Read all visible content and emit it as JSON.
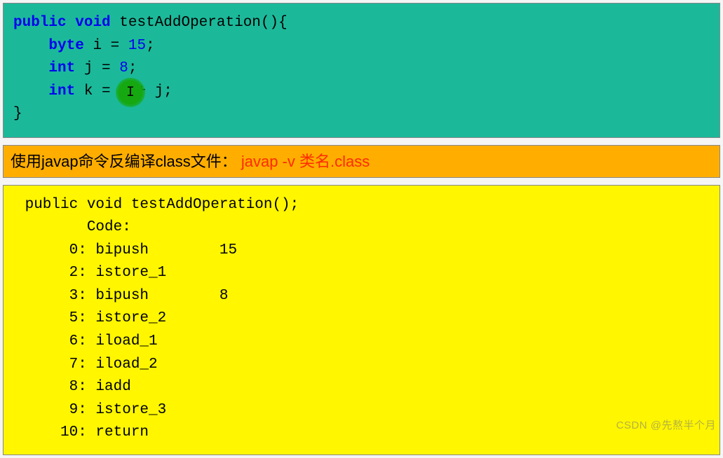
{
  "source": {
    "tokens": [
      {
        "t": "kw",
        "v": "public"
      },
      {
        "t": "sp",
        "v": " "
      },
      {
        "t": "kw",
        "v": "void"
      },
      {
        "t": "sp",
        "v": " "
      },
      {
        "t": "id",
        "v": "testAddOperation(){"
      },
      {
        "t": "nl"
      },
      {
        "t": "sp",
        "v": "    "
      },
      {
        "t": "kw",
        "v": "byte"
      },
      {
        "t": "sp",
        "v": " "
      },
      {
        "t": "id",
        "v": "i = "
      },
      {
        "t": "num",
        "v": "15"
      },
      {
        "t": "id",
        "v": ";"
      },
      {
        "t": "nl"
      },
      {
        "t": "sp",
        "v": "    "
      },
      {
        "t": "kw",
        "v": "int"
      },
      {
        "t": "sp",
        "v": " "
      },
      {
        "t": "id",
        "v": "j = "
      },
      {
        "t": "num",
        "v": "8"
      },
      {
        "t": "id",
        "v": ";"
      },
      {
        "t": "nl"
      },
      {
        "t": "sp",
        "v": "    "
      },
      {
        "t": "kw",
        "v": "int"
      },
      {
        "t": "sp",
        "v": " "
      },
      {
        "t": "id",
        "v": "k = i + j;"
      },
      {
        "t": "nl"
      },
      {
        "t": "id",
        "v": "}"
      }
    ]
  },
  "caption": {
    "black": "使用javap命令反编译class文件： ",
    "red": "javap -v 类名.class"
  },
  "bytecode": {
    "text": " public void testAddOperation();\n        Code:\n      0: bipush        15\n      2: istore_1\n      3: bipush        8\n      5: istore_2\n      6: iload_1\n      7: iload_2\n      8: iadd\n      9: istore_3\n     10: return"
  },
  "cursor_glyph": "I",
  "watermark": "CSDN @先熬半个月"
}
